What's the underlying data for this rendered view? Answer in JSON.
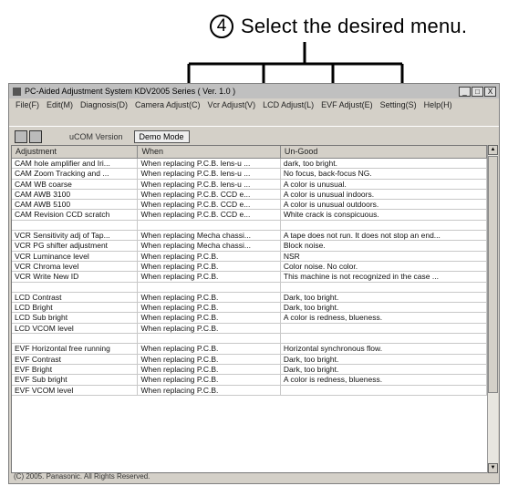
{
  "callout": {
    "number": "4",
    "text": "Select the desired menu."
  },
  "window": {
    "title": "PC-Aided Adjustment System KDV2005 Series  ( Ver. 1.0 )",
    "controls": [
      "_",
      "□",
      "X"
    ]
  },
  "menu": [
    "File(F)",
    "Edit(M)",
    "Diagnosis(D)",
    "Camera Adjust(C)",
    "Vcr Adjust(V)",
    "LCD Adjust(L)",
    "EVF Adjust(E)",
    "Setting(S)",
    "Help(H)"
  ],
  "toolbar": {
    "version_label": "uCOM Version",
    "mode_value": "Demo Mode"
  },
  "table": {
    "headers": [
      "Adjustment",
      "When",
      "Un-Good"
    ],
    "rows": [
      [
        "CAM hole amplifier and Iri...",
        "When replacing P.C.B. lens-u ...",
        "dark, too bright."
      ],
      [
        "CAM Zoom Tracking and ...",
        "When replacing P.C.B. lens-u ...",
        "No focus, back-focus NG."
      ],
      [
        "CAM WB coarse",
        "When replacing P.C.B. lens-u ...",
        "A color is unusual."
      ],
      [
        "CAM AWB 3100",
        "When replacing P.C.B. CCD e...",
        "A color is unusual indoors."
      ],
      [
        "CAM AWB 5100",
        "When replacing P.C.B. CCD e...",
        "A color is unusual outdoors."
      ],
      [
        "CAM Revision CCD scratch",
        "When replacing P.C.B. CCD e...",
        "White crack is conspicuous."
      ],
      [
        "",
        "",
        ""
      ],
      [
        "VCR Sensitivity adj of Tap...",
        "When replacing Mecha chassi...",
        "A tape does not run. It does not stop an end..."
      ],
      [
        "VCR PG shifter adjustment",
        "When replacing Mecha chassi...",
        "Block noise."
      ],
      [
        "VCR Luminance level",
        "When replacing P.C.B.",
        "NSR"
      ],
      [
        "VCR Chroma level",
        "When replacing P.C.B.",
        "Color noise. No color."
      ],
      [
        "VCR Write New ID",
        "When replacing P.C.B.",
        "This machine is not recognized in the case ..."
      ],
      [
        "",
        "",
        ""
      ],
      [
        "LCD Contrast",
        "When replacing P.C.B.",
        "Dark, too bright."
      ],
      [
        "LCD Bright",
        "When replacing P.C.B.",
        "Dark, too bright."
      ],
      [
        "LCD Sub bright",
        "When replacing P.C.B.",
        "A color is redness, blueness."
      ],
      [
        "LCD VCOM level",
        "When replacing P.C.B.",
        ""
      ],
      [
        "",
        "",
        ""
      ],
      [
        "EVF Horizontal free running",
        "When replacing P.C.B.",
        "Horizontal synchronous flow."
      ],
      [
        "EVF Contrast",
        "When replacing P.C.B.",
        "Dark, too bright."
      ],
      [
        "EVF Bright",
        "When replacing P.C.B.",
        "Dark, too bright."
      ],
      [
        "EVF Sub bright",
        "When replacing P.C.B.",
        "A color is redness, blueness."
      ],
      [
        "EVF VCOM level",
        "When replacing P.C.B.",
        ""
      ]
    ]
  },
  "status": "(C) 2005. Panasonic. All Rights Reserved."
}
